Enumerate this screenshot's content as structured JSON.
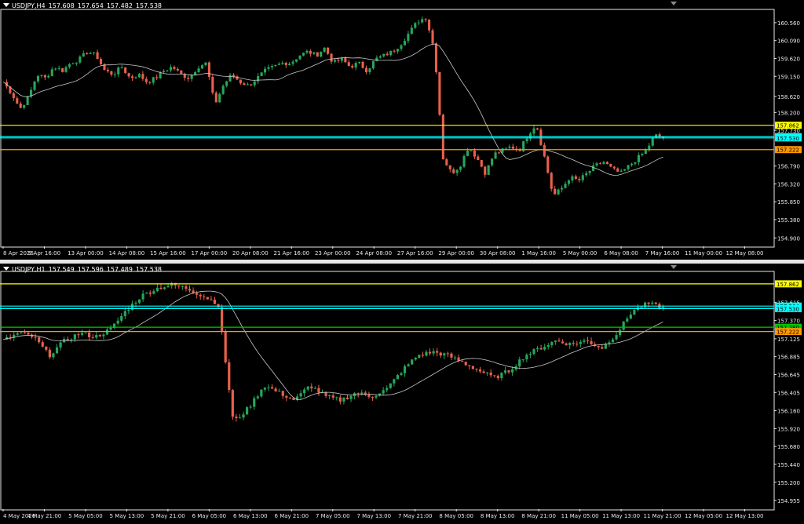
{
  "panes": [
    {
      "id": "h4",
      "symbol": "USDJPY,H4",
      "ohlc": [
        "157.608",
        "157.654",
        "157.482",
        "157.538"
      ],
      "chart_data": {
        "type": "candlestick",
        "ylim": [
          154.7,
          160.95
        ],
        "y_ticks": [
          "160.560",
          "160.090",
          "159.620",
          "159.150",
          "158.620",
          "158.200",
          "157.730",
          "156.790",
          "156.320",
          "155.850",
          "155.380",
          "154.900"
        ],
        "x_ticks": [
          "8 Apr 2026",
          "9 Apr 16:00",
          "13 Apr 00:00",
          "14 Apr 08:00",
          "15 Apr 16:00",
          "17 Apr 00:00",
          "20 Apr 08:00",
          "21 Apr 16:00",
          "23 Apr 00:00",
          "24 Apr 08:00",
          "27 Apr 16:00",
          "29 Apr 00:00",
          "30 Apr 08:00",
          "1 May 16:00",
          "5 May 00:00",
          "6 May 08:00",
          "7 May 16:00",
          "11 May 00:00",
          "12 May 08:00"
        ],
        "levels": [
          {
            "value": 157.862,
            "label": "157.862",
            "color": "#ffff00"
          },
          {
            "value": 157.564,
            "label": "157.564",
            "color": "#00ffff"
          },
          {
            "value": 157.53,
            "label": "157.530",
            "color": "#00ffff"
          },
          {
            "value": 157.222,
            "label": "157.222",
            "color": "#ff9900"
          }
        ],
        "anchors": [
          159.0,
          158.7,
          158.3,
          158.6,
          159.2,
          159.1,
          159.4,
          159.3,
          159.5,
          159.6,
          159.8,
          159.7,
          159.3,
          159.2,
          159.4,
          159.1,
          159.2,
          159.0,
          159.1,
          159.3,
          159.4,
          159.2,
          159.1,
          159.4,
          159.5,
          158.4,
          158.9,
          159.2,
          159.0,
          158.9,
          159.1,
          159.3,
          159.4,
          159.5,
          159.5,
          159.7,
          159.8,
          159.7,
          159.9,
          159.5,
          159.6,
          159.4,
          159.5,
          159.3,
          159.6,
          159.7,
          159.8,
          160.0,
          160.3,
          160.6,
          160.7,
          159.8,
          157.0,
          156.6,
          156.8,
          157.3,
          157.0,
          156.6,
          157.1,
          157.2,
          157.3,
          157.2,
          157.6,
          157.9,
          157.0,
          156.0,
          156.2,
          156.5,
          156.4,
          156.6,
          156.8,
          156.9,
          156.7,
          156.6,
          156.8,
          157.0,
          157.2,
          157.6,
          157.54
        ],
        "candle_count": 190,
        "ma_color": "#c8c8c8",
        "up_color": "#26a65b",
        "down_color": "#e8604c"
      }
    },
    {
      "id": "h1",
      "symbol": "USDJPY,H1",
      "ohlc": [
        "157.549",
        "157.596",
        "157.489",
        "157.538"
      ],
      "chart_data": {
        "type": "candlestick",
        "ylim": [
          154.85,
          158.05
        ],
        "y_ticks": [
          "157.615",
          "157.370",
          "157.125",
          "156.885",
          "156.645",
          "156.405",
          "156.160",
          "155.920",
          "155.680",
          "155.440",
          "155.200",
          "154.955"
        ],
        "x_ticks": [
          "4 May 2026",
          "4 May 21:00",
          "5 May 05:00",
          "5 May 13:00",
          "5 May 21:00",
          "6 May 05:00",
          "6 May 13:00",
          "6 May 21:00",
          "7 May 05:00",
          "7 May 13:00",
          "7 May 21:00",
          "8 May 05:00",
          "8 May 13:00",
          "8 May 21:00",
          "11 May 05:00",
          "11 May 13:00",
          "11 May 21:00",
          "12 May 05:00",
          "12 May 13:00"
        ],
        "levels": [
          {
            "value": 157.862,
            "label": "157.862",
            "color": "#ffff00"
          },
          {
            "value": 157.564,
            "label": "157.564",
            "color": "#00ffff"
          },
          {
            "value": 157.53,
            "label": "157.530",
            "color": "#00ffff"
          },
          {
            "value": 157.28,
            "label": "157.280",
            "color": "#00cc00"
          },
          {
            "value": 157.222,
            "label": "157.222",
            "color": "#ff9900"
          }
        ],
        "anchors": [
          157.1,
          157.2,
          157.15,
          156.9,
          157.1,
          157.2,
          157.15,
          157.25,
          157.5,
          157.7,
          157.8,
          157.85,
          157.8,
          157.7,
          157.6,
          156.0,
          156.2,
          156.5,
          156.4,
          156.3,
          156.5,
          156.35,
          156.3,
          156.4,
          156.35,
          156.45,
          156.7,
          156.9,
          156.95,
          156.9,
          156.8,
          156.7,
          156.6,
          156.7,
          156.9,
          157.0,
          157.1,
          157.05,
          157.1,
          157.0,
          157.2,
          157.5,
          157.6,
          157.54
        ],
        "candle_count": 185,
        "ma_color": "#c8c8c8",
        "up_color": "#26a65b",
        "down_color": "#e8604c"
      }
    }
  ]
}
